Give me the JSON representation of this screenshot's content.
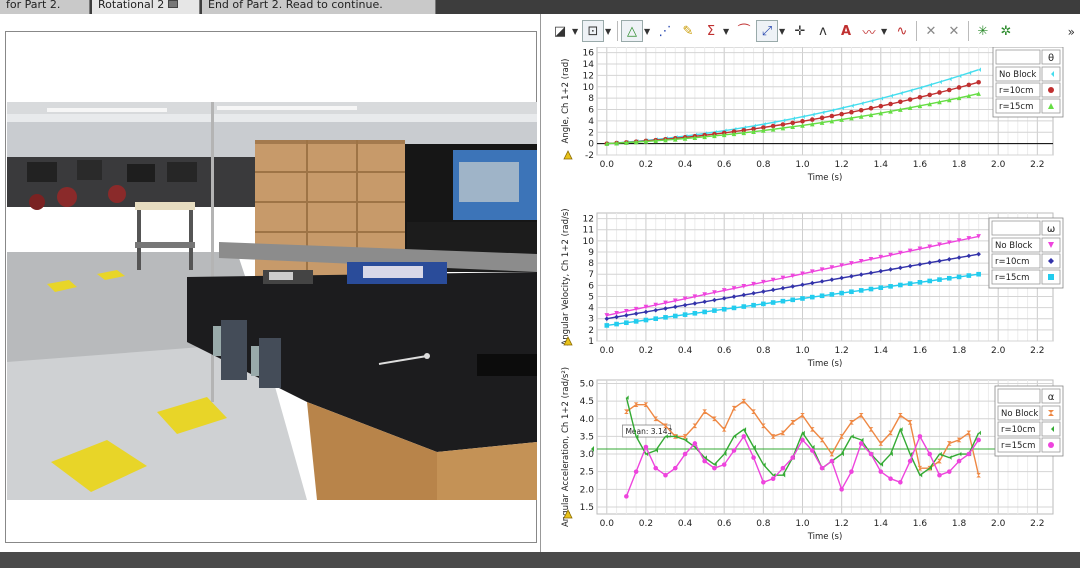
{
  "tabs": [
    {
      "label": "for Part 2.",
      "left": 0,
      "width": 90
    },
    {
      "label": "Rotational 2",
      "left": 92,
      "width": 108,
      "active": true
    },
    {
      "label": "End of Part 2.  Read to continue.",
      "left": 202,
      "width": 234
    }
  ],
  "graphs": [
    {
      "id": "angle",
      "ylabel": "Angle, Ch 1+2 (rad)",
      "xlabel": "Time (s)",
      "ylim": [
        -2,
        17
      ],
      "yticks": [
        -2,
        0,
        2,
        4,
        6,
        8,
        10,
        12,
        14,
        16
      ],
      "legend_symbol": "θ",
      "legend": [
        {
          "name": "No Block",
          "color": "#44ddee",
          "marker": "bowtie"
        },
        {
          "name": "r=10cm",
          "color": "#c03030",
          "marker": "circle"
        },
        {
          "name": "r=15cm",
          "color": "#66dd44",
          "marker": "triangle"
        }
      ]
    },
    {
      "id": "omega",
      "ylabel": "Angular Velocity, Ch 1+2 (rad/s)",
      "xlabel": "Time (s)",
      "ylim": [
        1,
        12.5
      ],
      "yticks": [
        1,
        2,
        3,
        4,
        5,
        6,
        7,
        8,
        9,
        10,
        11,
        12
      ],
      "legend_symbol": "ω",
      "legend": [
        {
          "name": "No Block",
          "color": "#ee44dd",
          "marker": "triangle-down"
        },
        {
          "name": "r=10cm",
          "color": "#3333aa",
          "marker": "diamond"
        },
        {
          "name": "r=15cm",
          "color": "#22ccee",
          "marker": "square"
        }
      ]
    },
    {
      "id": "alpha",
      "ylabel": "Angular Acceleration, Ch 1+2 (rad/s²)",
      "xlabel": "Time (s)",
      "ylim": [
        1.3,
        5.1
      ],
      "yticks": [
        1.5,
        2.0,
        2.5,
        3.0,
        3.5,
        4.0,
        4.5,
        5.0
      ],
      "legend_symbol": "α",
      "annotation": "Mean: 3.143",
      "legend": [
        {
          "name": "No Block",
          "color": "#ee8844",
          "marker": "hourglass"
        },
        {
          "name": "r=10cm",
          "color": "#33aa33",
          "marker": "bowtie"
        },
        {
          "name": "r=15cm",
          "color": "#ee44dd",
          "marker": "circle"
        }
      ]
    }
  ],
  "xticks": [
    "0.0",
    "0.2",
    "0.4",
    "0.6",
    "0.8",
    "1.0",
    "1.2",
    "1.4",
    "1.6",
    "1.8",
    "2.0",
    "2.2"
  ],
  "chart_data": [
    {
      "type": "line",
      "title": "",
      "xlabel": "Time (s)",
      "ylabel": "Angle, Ch 1+2 (rad)",
      "xlim": [
        -0.05,
        2.28
      ],
      "ylim": [
        -2,
        17
      ],
      "series": [
        {
          "name": "No Block",
          "x": [
            0,
            1.9
          ],
          "y": [
            0,
            13.0
          ]
        },
        {
          "name": "r=10cm",
          "x": [
            0,
            1.9
          ],
          "y": [
            0,
            10.8
          ]
        },
        {
          "name": "r=15cm",
          "x": [
            0,
            1.9
          ],
          "y": [
            0,
            8.8
          ]
        }
      ]
    },
    {
      "type": "line",
      "title": "",
      "xlabel": "Time (s)",
      "ylabel": "Angular Velocity, Ch 1+2 (rad/s)",
      "xlim": [
        -0.05,
        2.28
      ],
      "ylim": [
        1,
        12.5
      ],
      "series": [
        {
          "name": "No Block",
          "x": [
            0,
            1.9
          ],
          "y": [
            3.3,
            10.4
          ]
        },
        {
          "name": "r=10cm",
          "x": [
            0,
            1.9
          ],
          "y": [
            3.0,
            8.8
          ]
        },
        {
          "name": "r=15cm",
          "x": [
            0,
            1.9
          ],
          "y": [
            2.4,
            7.0
          ]
        }
      ]
    },
    {
      "type": "line",
      "title": "",
      "xlabel": "Time (s)",
      "ylabel": "Angular Acceleration, Ch 1+2 (rad/s²)",
      "xlim": [
        -0.05,
        2.28
      ],
      "ylim": [
        1.3,
        5.1
      ],
      "mean": 3.143,
      "series": [
        {
          "name": "No Block",
          "x": [
            0.1,
            0.15,
            0.2,
            0.25,
            0.3,
            0.35,
            0.4,
            0.45,
            0.5,
            0.55,
            0.6,
            0.65,
            0.7,
            0.75,
            0.8,
            0.85,
            0.9,
            0.95,
            1.0,
            1.05,
            1.1,
            1.15,
            1.2,
            1.25,
            1.3,
            1.35,
            1.4,
            1.45,
            1.5,
            1.55,
            1.6,
            1.65,
            1.7,
            1.75,
            1.8,
            1.85,
            1.9
          ],
          "y": [
            4.2,
            4.4,
            4.4,
            4.0,
            3.8,
            3.5,
            3.5,
            3.8,
            4.2,
            4.0,
            3.7,
            4.3,
            4.5,
            4.2,
            3.8,
            3.5,
            3.6,
            3.9,
            4.1,
            3.7,
            3.4,
            3.0,
            3.5,
            3.9,
            4.1,
            3.7,
            3.3,
            3.6,
            4.1,
            3.9,
            2.6,
            2.6,
            2.8,
            3.3,
            3.4,
            3.6,
            2.4
          ]
        },
        {
          "name": "r=10cm",
          "x": [
            0.1,
            0.15,
            0.2,
            0.25,
            0.3,
            0.35,
            0.4,
            0.45,
            0.5,
            0.55,
            0.6,
            0.65,
            0.7,
            0.75,
            0.8,
            0.85,
            0.9,
            0.95,
            1.0,
            1.05,
            1.1,
            1.15,
            1.2,
            1.25,
            1.3,
            1.35,
            1.4,
            1.45,
            1.5,
            1.55,
            1.6,
            1.65,
            1.7,
            1.75,
            1.8,
            1.85,
            1.9
          ],
          "y": [
            4.6,
            3.5,
            3.0,
            3.1,
            3.5,
            3.5,
            3.4,
            3.2,
            2.9,
            2.7,
            3.0,
            3.5,
            3.7,
            3.2,
            2.7,
            2.4,
            2.4,
            2.9,
            3.6,
            3.2,
            2.6,
            2.8,
            3.0,
            3.5,
            3.4,
            3.0,
            2.7,
            3.0,
            3.7,
            3.0,
            2.4,
            2.6,
            3.0,
            2.9,
            3.0,
            3.0,
            3.6
          ]
        },
        {
          "name": "r=15cm",
          "x": [
            0.1,
            0.15,
            0.2,
            0.25,
            0.3,
            0.35,
            0.4,
            0.45,
            0.5,
            0.55,
            0.6,
            0.65,
            0.7,
            0.75,
            0.8,
            0.85,
            0.9,
            0.95,
            1.0,
            1.05,
            1.1,
            1.15,
            1.2,
            1.25,
            1.3,
            1.35,
            1.4,
            1.45,
            1.5,
            1.55,
            1.6,
            1.65,
            1.7,
            1.75,
            1.8,
            1.85,
            1.9
          ],
          "y": [
            1.8,
            2.5,
            3.2,
            2.6,
            2.4,
            2.6,
            3.0,
            3.3,
            2.8,
            2.6,
            2.7,
            3.1,
            3.5,
            2.9,
            2.2,
            2.3,
            2.6,
            2.9,
            3.4,
            3.1,
            2.6,
            2.8,
            2.0,
            2.5,
            3.3,
            3.0,
            2.5,
            2.3,
            2.2,
            2.8,
            3.5,
            3.0,
            2.4,
            2.5,
            2.8,
            3.0,
            3.4
          ]
        }
      ]
    }
  ]
}
